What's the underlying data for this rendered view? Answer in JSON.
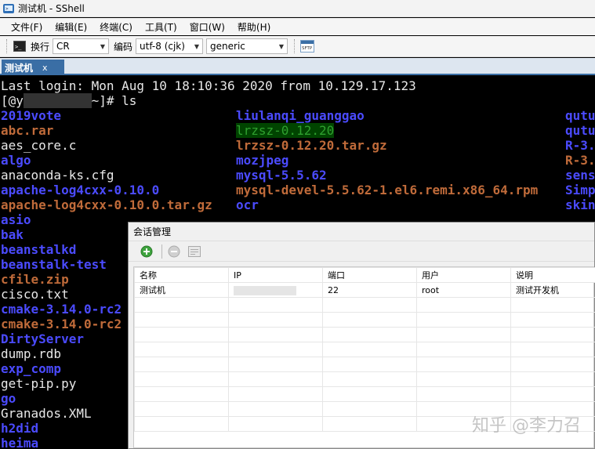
{
  "window": {
    "title": "测试机 - SShell",
    "accent": "#3a6ea5"
  },
  "menu": [
    "文件(F)",
    "编辑(E)",
    "终端(C)",
    "工具(T)",
    "窗口(W)",
    "帮助(H)"
  ],
  "toolbar": {
    "newline_label": "换行",
    "newline_value": "CR",
    "encoding_label": "编码",
    "encoding_value": "utf-8 (cjk)",
    "terminal_type_value": "generic",
    "sftp_icon_text": "SFTP"
  },
  "tab": {
    "label": "测试机",
    "close": "x"
  },
  "terminal": {
    "login_line": "Last login: Mon Aug 10 18:10:36 2020 from 10.129.17.123",
    "prompt_prefix": "[@y",
    "prompt_suffix": "~]# ls",
    "col1": [
      {
        "text": "2019vote",
        "kind": "dir"
      },
      {
        "text": "abc.rar",
        "kind": "arc"
      },
      {
        "text": "aes_core.c",
        "kind": "file"
      },
      {
        "text": "algo",
        "kind": "dir"
      },
      {
        "text": "anaconda-ks.cfg",
        "kind": "file"
      },
      {
        "text": "apache-log4cxx-0.10.0",
        "kind": "dir"
      },
      {
        "text": "apache-log4cxx-0.10.0.tar.gz",
        "kind": "arc"
      },
      {
        "text": "asio",
        "kind": "dir"
      },
      {
        "text": "bak",
        "kind": "dir"
      },
      {
        "text": "beanstalkd",
        "kind": "dir"
      },
      {
        "text": "beanstalk-test",
        "kind": "dir"
      },
      {
        "text": "cfile.zip",
        "kind": "arc"
      },
      {
        "text": "cisco.txt",
        "kind": "file"
      },
      {
        "text": "cmake-3.14.0-rc2",
        "kind": "dir"
      },
      {
        "text": "cmake-3.14.0-rc2",
        "kind": "arc"
      },
      {
        "text": "DirtyServer",
        "kind": "dir"
      },
      {
        "text": "dump.rdb",
        "kind": "file"
      },
      {
        "text": "exp_comp",
        "kind": "dir"
      },
      {
        "text": "get-pip.py",
        "kind": "file"
      },
      {
        "text": "go",
        "kind": "dir"
      },
      {
        "text": "Granados.XML",
        "kind": "file"
      },
      {
        "text": "h2did",
        "kind": "dir"
      },
      {
        "text": "heima",
        "kind": "dir"
      }
    ],
    "col2": [
      {
        "text": "liulanqi_guanggao",
        "kind": "dir"
      },
      {
        "text": "lrzsz-0.12.20",
        "kind": "hl"
      },
      {
        "text": "lrzsz-0.12.20.tar.gz",
        "kind": "arc"
      },
      {
        "text": "mozjpeg",
        "kind": "dir"
      },
      {
        "text": "mysql-5.5.62",
        "kind": "dir"
      },
      {
        "text": "mysql-devel-5.5.62-1.el6.remi.x86_64.rpm",
        "kind": "arc"
      },
      {
        "text": "ocr",
        "kind": "dir"
      }
    ],
    "col3": [
      {
        "text": "qutu",
        "kind": "dir"
      },
      {
        "text": "qutu",
        "kind": "dir"
      },
      {
        "text": "R-3.",
        "kind": "dir"
      },
      {
        "text": "R-3.",
        "kind": "arc"
      },
      {
        "text": "sens",
        "kind": "dir"
      },
      {
        "text": "Simp",
        "kind": "dir"
      },
      {
        "text": "skin",
        "kind": "dir"
      }
    ]
  },
  "dialog": {
    "title": "会话管理",
    "columns": [
      "名称",
      "IP",
      "端口",
      "用户",
      "说明"
    ],
    "rows": [
      {
        "name": "测试机",
        "ip": "",
        "port": "22",
        "user": "root",
        "desc": "测试开发机"
      }
    ]
  },
  "watermark": "知乎 @李力召"
}
